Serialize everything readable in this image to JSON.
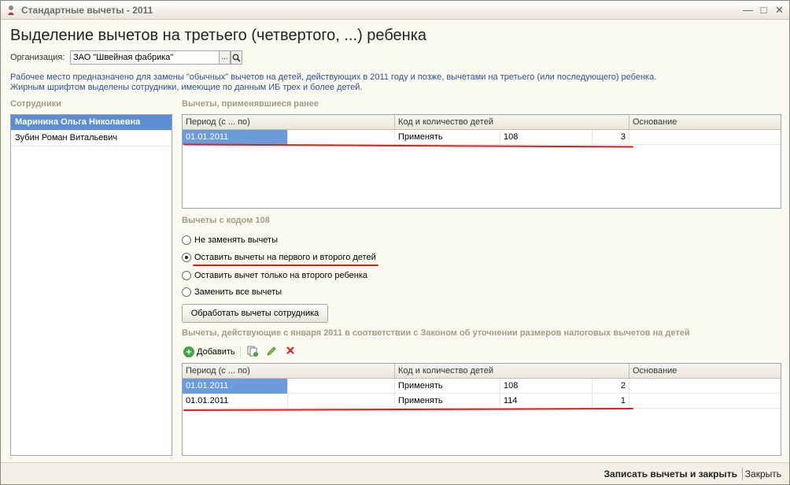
{
  "window": {
    "title": "Стандартные вычеты - 2011",
    "minimize_icon": "minimize-icon",
    "maximize_icon": "maximize-icon",
    "close_icon": "close-icon"
  },
  "page_title": "Выделение вычетов на третьего (четвертого, ...) ребенка",
  "organization": {
    "label": "Организация:",
    "value": "ЗАО \"Швейная фабрика\"",
    "select_button": "...",
    "open_icon": "magnifier-icon"
  },
  "info": {
    "line1": "Рабочее место предназначено для замены \"обычных\" вычетов на детей, действующих в 2011 году и позже, вычетами на третьего (или последующего) ребенка.",
    "line2": "Жирным шрифтом выделены сотрудники, имеющие по данным ИБ трех и более детей."
  },
  "employees": {
    "label": "Сотрудники",
    "items": [
      {
        "name": "Маринина Ольга Николаевна",
        "bold": true,
        "selected": true
      },
      {
        "name": "Зубин Роман Витальевич",
        "bold": false,
        "selected": false
      }
    ]
  },
  "previous_deductions": {
    "label": "Вычеты, применявшиеся ранее",
    "headers": [
      "Период (с ... по)",
      "Код и количество детей",
      "Основание"
    ],
    "rows": [
      {
        "period": "01.01.2011",
        "apply": "Применять",
        "code": "108",
        "count": "3",
        "basis": ""
      }
    ]
  },
  "code_108": {
    "label": "Вычеты с кодом 108",
    "options": [
      {
        "label": "Не заменять вычеты",
        "checked": false
      },
      {
        "label": "Оставить вычеты на первого и второго детей",
        "checked": true
      },
      {
        "label": "Оставить вычет только на второго ребенка",
        "checked": false
      },
      {
        "label": "Заменить все вычеты",
        "checked": false
      }
    ],
    "process_button": "Обработать вычеты сотрудника"
  },
  "new_deductions": {
    "label": "Вычеты, действующие с января 2011 в соответствии с Законом об уточнении размеров налоговых вычетов на детей",
    "toolbar": {
      "add_label": "Добавить",
      "add_icon": "plus-circle-icon",
      "copy_icon": "copy-icon",
      "edit_icon": "pencil-icon",
      "delete_icon": "delete-x-icon"
    },
    "headers": [
      "Период (с ... по)",
      "Код и количество детей",
      "Основание"
    ],
    "rows": [
      {
        "period": "01.01.2011",
        "apply": "Применять",
        "code": "108",
        "count": "2",
        "basis": ""
      },
      {
        "period": "01.01.2011",
        "apply": "Применять",
        "code": "114",
        "count": "1",
        "basis": ""
      }
    ]
  },
  "footer": {
    "save_close": "Записать вычеты и закрыть",
    "close": "Закрыть"
  },
  "colors": {
    "accent_blue": "#5d8ed3",
    "info_text": "#2c4f9a",
    "section_label": "#9f9d86",
    "annotation_red": "#e41b1b"
  }
}
